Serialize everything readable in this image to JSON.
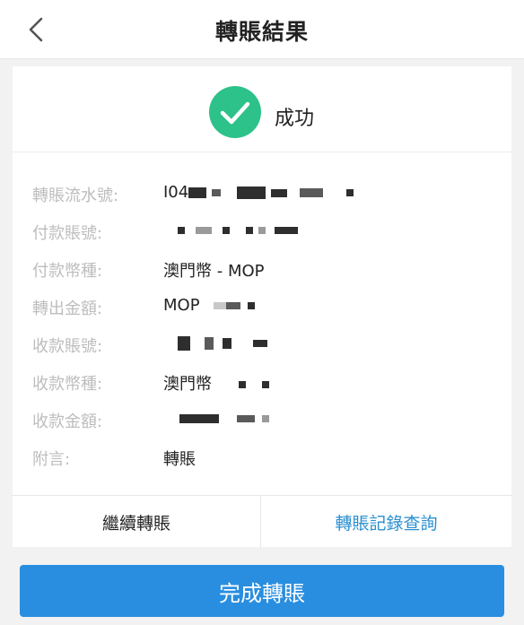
{
  "header": {
    "title": "轉賬結果",
    "back_icon": "chevron-left-icon"
  },
  "status": {
    "text": "成功",
    "icon": "check-circle-icon",
    "icon_color": "#2cc28a"
  },
  "details": [
    {
      "label": "轉賬流水號:",
      "value": "I04"
    },
    {
      "label": "付款賬號:",
      "value": ""
    },
    {
      "label": "付款幣種:",
      "value": "澳門幣 - MOP"
    },
    {
      "label": "轉出金額:",
      "value": "MOP"
    },
    {
      "label": "收款賬號:",
      "value": ""
    },
    {
      "label": "收款幣種:",
      "value": "澳門幣"
    },
    {
      "label": "收款金額:",
      "value": ""
    },
    {
      "label": "附言:",
      "value": "轉賬"
    }
  ],
  "actions": {
    "continue_label": "繼續轉賬",
    "history_label": "轉賬記錄查詢"
  },
  "footer": {
    "done_label": "完成轉賬"
  },
  "colors": {
    "accent": "#2a8ee0",
    "link": "#2a8fcf",
    "success": "#2cc28a"
  }
}
